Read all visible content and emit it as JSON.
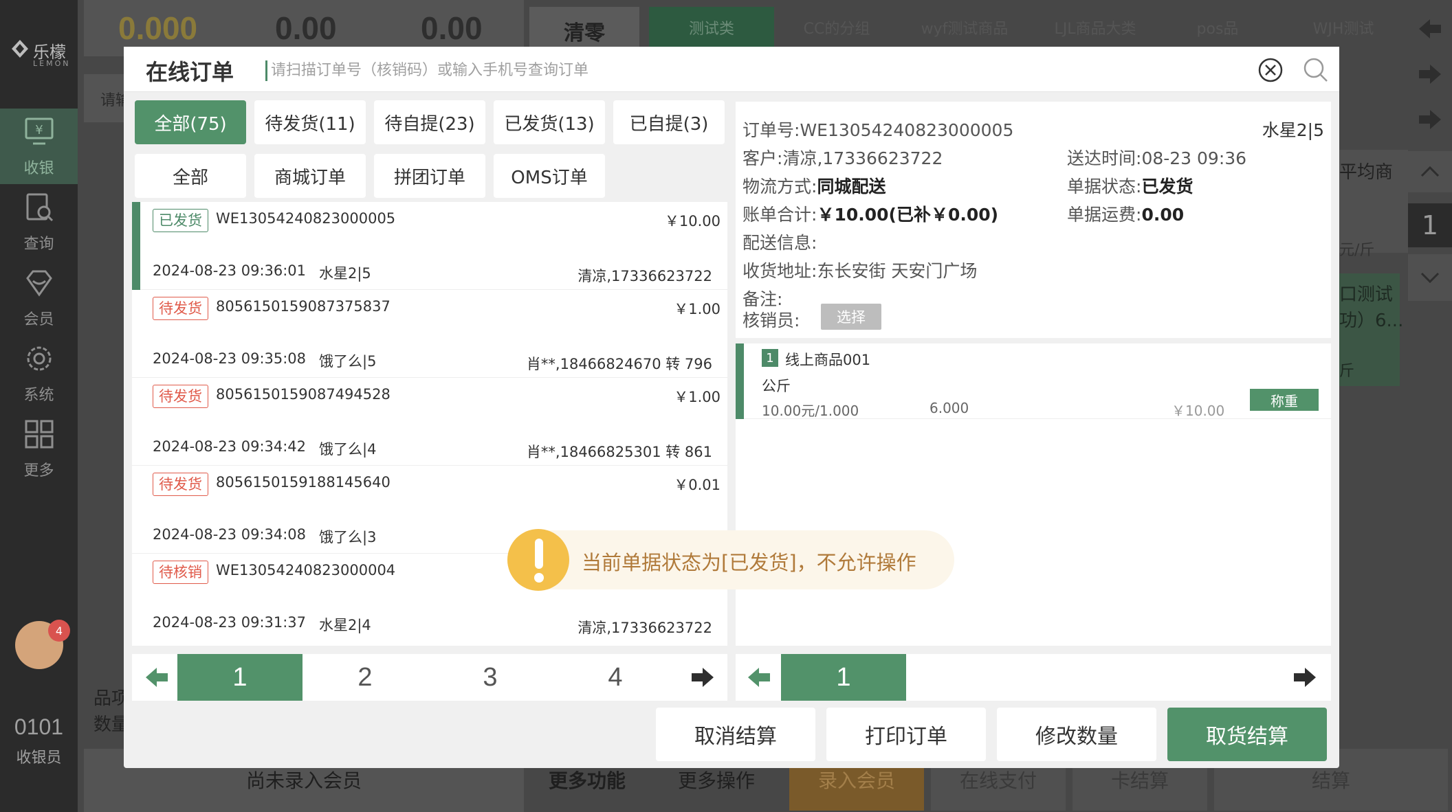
{
  "sidebar": {
    "logo_name": "乐檬",
    "logo_sub": "LEMON",
    "items": [
      {
        "label": "收银"
      },
      {
        "label": "查询"
      },
      {
        "label": "会员"
      },
      {
        "label": "系统"
      },
      {
        "label": "更多"
      }
    ],
    "notification_count": "4",
    "cashier_no": "0101",
    "cashier_label": "收银员"
  },
  "topbar": {
    "amount_1": "0.000",
    "amount_2": "0.00",
    "amount_3": "0.00",
    "clear_label": "清零",
    "categories": [
      "测试类",
      "CC的分组",
      "wyf测试商品",
      "LJL商品大类",
      "pos品",
      "WJH测试"
    ]
  },
  "background": {
    "search_hint": "请输",
    "avg_text": "平均商",
    "per_kg": "元/斤",
    "product_name": "口测试",
    "product_line2": "功）6...",
    "product_unit": "斤",
    "qty_box": "1",
    "items_label": "品项",
    "qty_label": "数量"
  },
  "bottom_bar": {
    "member": "尚未录入会员",
    "more_func": "更多功能",
    "more_ops": "更多操作",
    "enter_member": "录入会员",
    "online_pay": "在线支付",
    "card_pay": "卡结算",
    "checkout": "结算"
  },
  "modal": {
    "title": "在线订单",
    "search_placeholder": "请扫描订单号（核销码）或输入手机号查询订单",
    "status_tabs": [
      "全部(75)",
      "待发货(11)",
      "待自提(23)",
      "已发货(13)",
      "已自提(3)"
    ],
    "type_tabs": [
      "全部",
      "商城订单",
      "拼团订单",
      "OMS订单"
    ],
    "orders": [
      {
        "status": "已发货",
        "type": "shipped",
        "no": "WE13054240823000005",
        "amount": "￥10.00",
        "time": "2024-08-23 09:36:01",
        "store": "水星2|5",
        "customer": "清凉,17336623722"
      },
      {
        "status": "待发货",
        "type": "pending",
        "no": "8056150159087375837",
        "amount": "￥1.00",
        "time": "2024-08-23 09:35:08",
        "store": "饿了么|5",
        "customer": "肖**,18466824670 转 796"
      },
      {
        "status": "待发货",
        "type": "pending",
        "no": "8056150159087494528",
        "amount": "￥1.00",
        "time": "2024-08-23 09:34:42",
        "store": "饿了么|4",
        "customer": "肖**,18466825301 转 861"
      },
      {
        "status": "待发货",
        "type": "pending",
        "no": "8056150159188145640",
        "amount": "￥0.01",
        "time": "2024-08-23 09:34:08",
        "store": "饿了么|3",
        "customer": ""
      },
      {
        "status": "待核销",
        "type": "pending",
        "no": "WE13054240823000004",
        "amount": "",
        "time": "2024-08-23 09:31:37",
        "store": "水星2|4",
        "customer": "清凉,17336623722"
      }
    ],
    "list_pages": [
      "1",
      "2",
      "3",
      "4"
    ],
    "detail": {
      "order_no_label": "订单号:",
      "order_no": "WE13054240823000005",
      "store": "水星2|5",
      "customer_label": "客户:",
      "customer": "清凉,17336623722",
      "delivery_time_label": "送达时间:",
      "delivery_time": "08-23 09:36",
      "logistics_label": "物流方式:",
      "logistics": "同城配送",
      "status_label": "单据状态:",
      "status": "已发货",
      "total_label": "账单合计:",
      "total": "￥10.00(已补￥0.00)",
      "freight_label": "单据运费:",
      "freight": "0.00",
      "delivery_info_label": "配送信息:",
      "address_label": "收货地址:",
      "address": "东长安街 天安门广场",
      "remark_label": "备注:",
      "verifier_label": "核销员:",
      "select_label": "选择"
    },
    "items": [
      {
        "idx": "1",
        "name": "线上商品001",
        "unit": "公斤",
        "price": "10.00元/1.000",
        "qty": "6.000",
        "total": "￥10.00",
        "weigh_label": "称重"
      }
    ],
    "item_pages": [
      "1"
    ],
    "actions": {
      "cancel": "取消结算",
      "print": "打印订单",
      "edit_qty": "修改数量",
      "pickup": "取货结算"
    },
    "toast": "当前单据状态为[已发货]，不允许操作"
  },
  "colors": {
    "accent": "#52926a",
    "pending": "#e05a4a",
    "toast_bg": "#fcf6ea",
    "toast_icon": "#f4c04a"
  }
}
